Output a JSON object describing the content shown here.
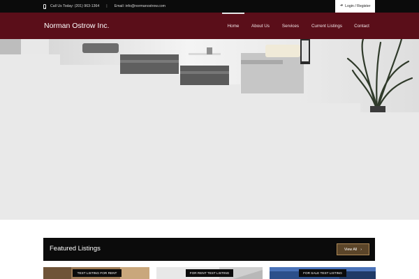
{
  "topbar": {
    "phone_text": "Call Us Today: (201) 963-1364",
    "separator": "|",
    "email_text": "Email: info@normanostrow.com",
    "login_label": "Login / Register"
  },
  "header": {
    "brand": "Norman Ostrow Inc.",
    "nav": [
      {
        "label": "Home",
        "active": true
      },
      {
        "label": "About Us",
        "active": false
      },
      {
        "label": "Services",
        "active": false
      },
      {
        "label": "Current Listings",
        "active": false
      },
      {
        "label": "Contact",
        "active": false
      }
    ]
  },
  "featured": {
    "title": "Featured Listings",
    "view_all_label": "View All"
  },
  "listings": [
    {
      "badge": "TEST LISTING FOR RENT"
    },
    {
      "badge": "FOR RENT TEST LISTING"
    },
    {
      "badge": "FOR SALE TEST LISTING"
    }
  ]
}
